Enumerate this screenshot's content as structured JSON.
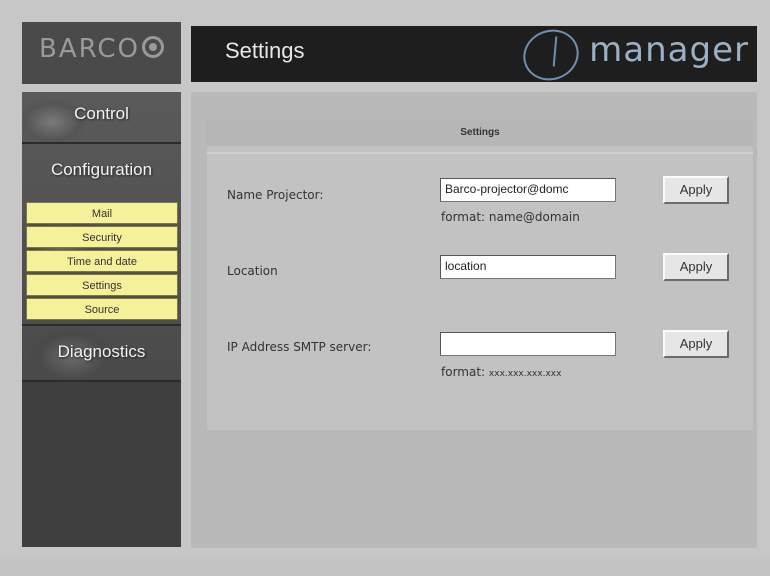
{
  "header": {
    "title": "Settings",
    "brand": "manager"
  },
  "logo": {
    "text": "BARCO"
  },
  "nav": {
    "control": "Control",
    "configuration": "Configuration",
    "submenu": [
      "Mail",
      "Security",
      "Time and date",
      "Settings",
      "Source"
    ],
    "diagnostics": "Diagnostics"
  },
  "panel": {
    "heading": "Settings"
  },
  "form": {
    "name_projector": {
      "label": "Name Projector:",
      "value": "Barco-projector@domc",
      "hint": "format: name@domain",
      "apply": "Apply"
    },
    "location": {
      "label": "Location",
      "value": "location",
      "apply": "Apply"
    },
    "smtp": {
      "label": "IP Address SMTP server:",
      "value": "",
      "hint_prefix": "format:",
      "hint_value": "xxx.xxx.xxx.xxx",
      "apply": "Apply"
    }
  },
  "colors": {
    "submenu_bg": "#f5f09a",
    "brand_blue": "#9bb0c4"
  }
}
